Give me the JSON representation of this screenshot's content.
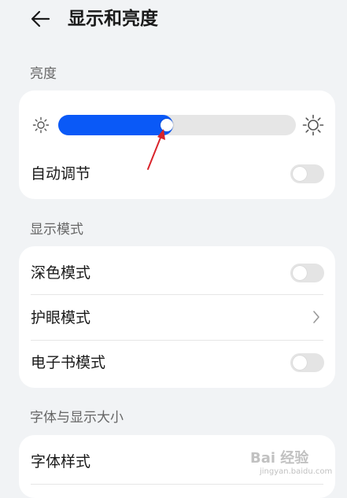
{
  "header": {
    "title": "显示和亮度",
    "back_icon": "arrow-left-icon"
  },
  "brightness": {
    "section_label": "亮度",
    "level_percent": 44,
    "low_icon": "sun-small-icon",
    "high_icon": "sun-large-icon",
    "auto_label": "自动调节",
    "auto_on": false
  },
  "display_mode": {
    "section_label": "显示模式",
    "items": [
      {
        "label": "深色模式",
        "control": "toggle",
        "on": false
      },
      {
        "label": "护眼模式",
        "control": "chevron"
      },
      {
        "label": "电子书模式",
        "control": "toggle",
        "on": false
      }
    ]
  },
  "font_size": {
    "section_label": "字体与显示大小",
    "items": [
      {
        "label": "字体样式"
      }
    ]
  },
  "watermark": {
    "text": "Bai 经验",
    "sub": "jingyan.baidu.com"
  },
  "colors": {
    "accent": "#0a59f7",
    "annotation_arrow": "#d9242b"
  }
}
